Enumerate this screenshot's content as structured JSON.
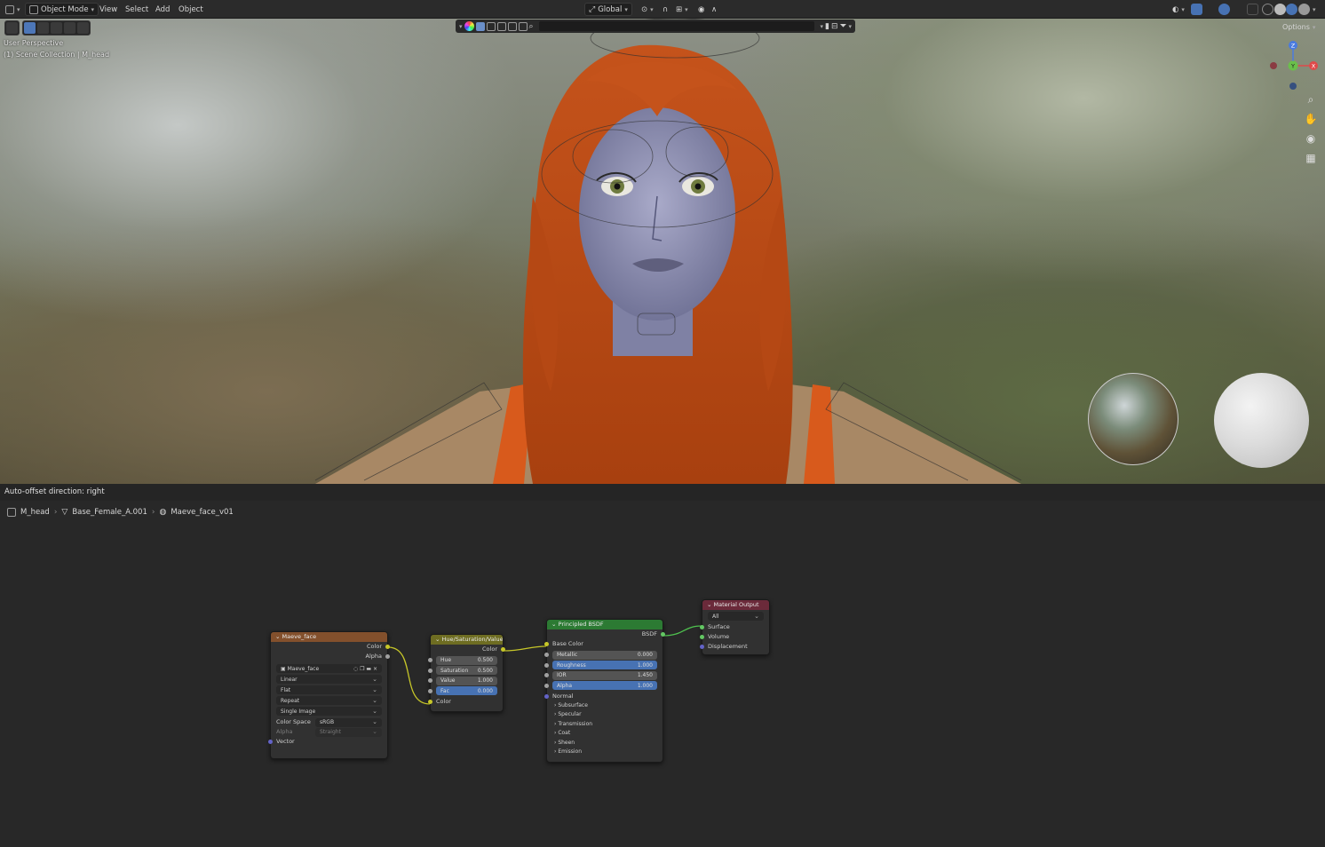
{
  "header": {
    "mode": "Object Mode",
    "menus": [
      "View",
      "Select",
      "Add",
      "Object"
    ],
    "transform_orientation": "Global",
    "options_label": "Options"
  },
  "viewport": {
    "view_name": "User Perspective",
    "collection_info": "(1) Scene Collection | M_head",
    "gizmo_axes": [
      "Z",
      "Y",
      "X"
    ],
    "nav_icons": [
      "zoom-icon",
      "hand-pan-icon",
      "camera-icon",
      "grid-icon"
    ]
  },
  "status": {
    "message": "Auto-offset direction: right"
  },
  "breadcrumb": {
    "object": "M_head",
    "mesh": "Base_Female_A.001",
    "material": "Maeve_face_v01"
  },
  "nodes": {
    "image_texture": {
      "title": "Maeve_face",
      "outputs": [
        "Color",
        "Alpha"
      ],
      "image_name": "Maeve_face",
      "interpolation": "Linear",
      "projection": "Flat",
      "extension": "Repeat",
      "source": "Single Image",
      "color_space_label": "Color Space",
      "color_space": "sRGB",
      "alpha_label": "Alpha",
      "alpha_mode": "Straight",
      "input": "Vector"
    },
    "hsv": {
      "title": "Hue/Saturation/Value",
      "output": "Color",
      "fields": [
        {
          "label": "Hue",
          "value": "0.500"
        },
        {
          "label": "Saturation",
          "value": "0.500"
        },
        {
          "label": "Value",
          "value": "1.000"
        },
        {
          "label": "Fac",
          "value": "0.000"
        }
      ],
      "input": "Color"
    },
    "bsdf": {
      "title": "Principled BSDF",
      "output": "BSDF",
      "base_color": "Base Color",
      "fields": [
        {
          "label": "Metallic",
          "value": "0.000"
        },
        {
          "label": "Roughness",
          "value": "1.000"
        },
        {
          "label": "IOR",
          "value": "1.450"
        },
        {
          "label": "Alpha",
          "value": "1.000"
        }
      ],
      "normal": "Normal",
      "panels": [
        "Subsurface",
        "Specular",
        "Transmission",
        "Coat",
        "Sheen",
        "Emission"
      ]
    },
    "output": {
      "title": "Material Output",
      "target": "All",
      "inputs": [
        "Surface",
        "Volume",
        "Displacement"
      ]
    }
  },
  "colors": {
    "texture_header": "#83502c",
    "hsv_header": "#6e6d22",
    "bsdf_header": "#2c7a33",
    "output_header": "#6b2a3a",
    "link": "#c7c729",
    "link_shader": "#4fc24f",
    "accent_blue": "#4772b3"
  }
}
